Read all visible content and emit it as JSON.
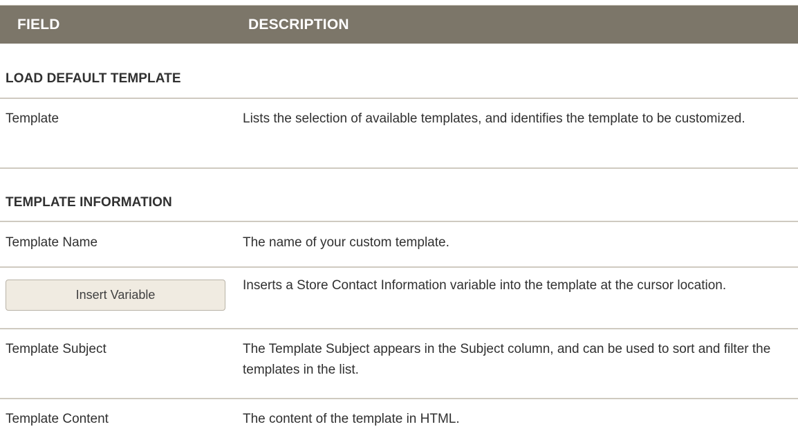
{
  "header": {
    "field_label": "FIELD",
    "description_label": "DESCRIPTION"
  },
  "sections": [
    {
      "title": "LOAD DEFAULT TEMPLATE",
      "rows": [
        {
          "field": "Template",
          "description": "Lists the selection of available templates, and identifies the template to be customized."
        }
      ]
    },
    {
      "title": "TEMPLATE INFORMATION",
      "rows": [
        {
          "field": "Template Name",
          "description": "The name of your custom template."
        },
        {
          "field_button": "Insert Variable",
          "description": "Inserts a Store Contact Information variable into the template at the cursor location."
        },
        {
          "field": "Template Subject",
          "description": "The Template Subject appears in the Subject column, and can be used to sort and filter the templates in the list."
        },
        {
          "field": "Template Content",
          "description": "The content of the template in HTML."
        }
      ]
    }
  ],
  "colors": {
    "header_background": "#7c7669",
    "header_text": "#ffffff",
    "rule": "#cfcac0",
    "button_background": "#f0ebe1"
  }
}
